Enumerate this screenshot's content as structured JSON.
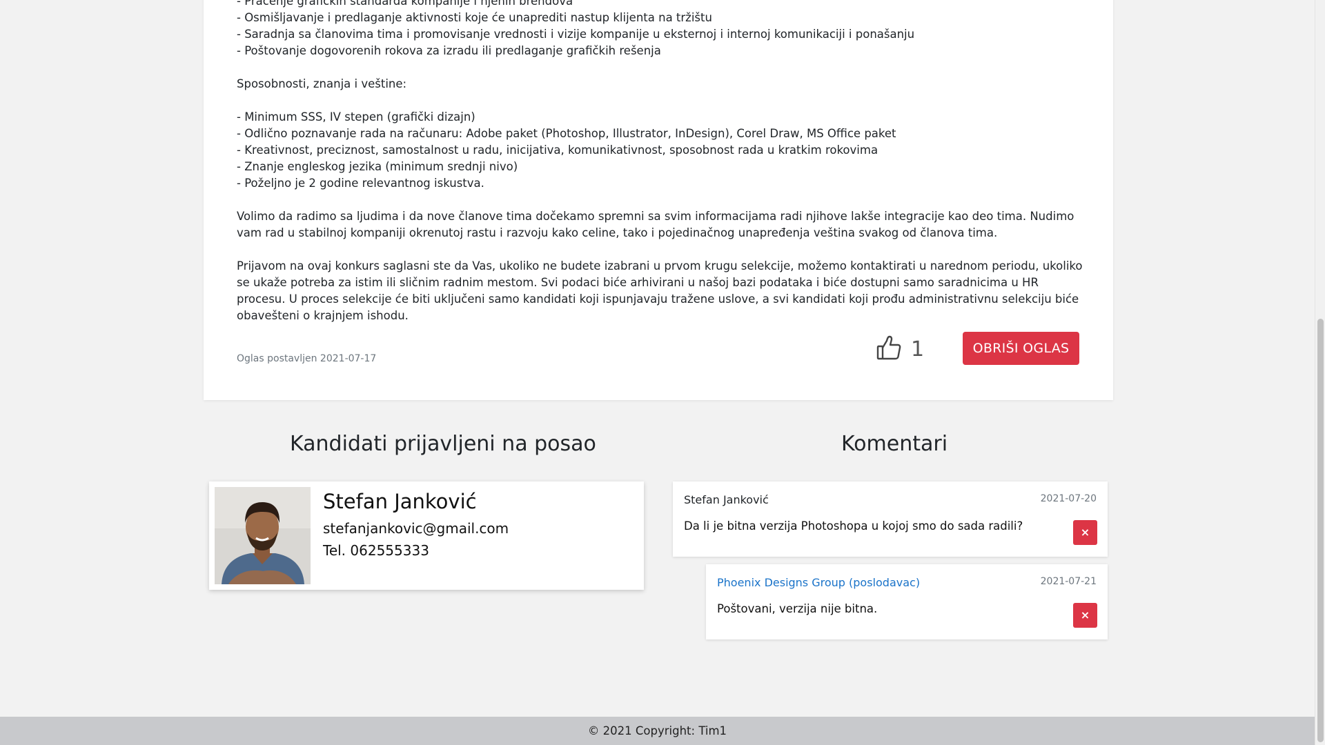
{
  "description": {
    "lines": [
      "- Praćenje grafičkih standarda kompanije i njenih brendova",
      "- Osmišljavanje i predlaganje aktivnosti koje će unaprediti nastup klijenta na tržištu",
      "- Saradnja sa članovima tima i promovisanje vrednosti i vizije kompanije u eksternoj i internoj komunikaciji i ponašanju",
      "- Poštovanje dogovorenih rokova za izradu ili predlaganje grafičkih rešenja"
    ],
    "skills_heading": "Sposobnosti, znanja i veštine:",
    "skills": [
      "- Minimum SSS, IV stepen (grafički dizajn)",
      "- Odlično poznavanje rada na računaru: Adobe paket (Photoshop, Illustrator, InDesign), Corel Draw, MS Office paket",
      "- Kreativnost, preciznost, samostalnost u radu, inicijativa, komunikativnost, sposobnost rada u kratkim rokovima",
      "- Znanje engleskog jezika (minimum srednji nivo)",
      "- Poželjno je 2 godine relevantnog iskustva."
    ],
    "paragraph1": "Volimo da radimo sa ljudima i da nove članove tima dočekamo spremni sa svim informacijama radi njihove lakše integracije kao deo tima. Nudimo vam rad u stabilnoj kompaniji okrenutoj rastu i razvoju kako celine, tako i pojedinačnog unapređenja veština svakog od članova tima.",
    "paragraph2": "Prijavom na ovaj konkurs saglasni ste da Vas, ukoliko ne budete izabrani u prvom krugu selekcije, možemo kontaktirati u narednom periodu, ukoliko se ukaže potreba za istim ili sličnim radnim mestom. Svi podaci biće arhivirani u našoj bazi podataka i biće dostupni samo saradnicima u HR procesu. U proces selekcije će biti uključeni samo kandidati koji ispunjavaju tražene uslove, a svi kandidati koji prođu administrativnu selekciju biće obavešteni o krajnjem ishodu."
  },
  "ad": {
    "posted": "Oglas postavljen 2021-07-17",
    "likes": "1",
    "delete_label": "OBRIŠI OGLAS",
    "like_icon": "thumbs-up-icon"
  },
  "candidates": {
    "title": "Kandidati prijavljeni na posao",
    "items": [
      {
        "name": "Stefan Janković",
        "email": "stefanjankovic@gmail.com",
        "phone": "Tel. 062555333"
      }
    ]
  },
  "comments": {
    "title": "Komentari",
    "items": [
      {
        "author": "Stefan Janković",
        "date": "2021-07-20",
        "text": "Da li je bitna verzija Photoshopa u kojoj smo do sada radili?",
        "delete_icon": "×"
      },
      {
        "author": "Phoenix Designs Group (poslodavac)",
        "date": "2021-07-21",
        "text": "Poštovani, verzija nije bitna.",
        "delete_icon": "×"
      }
    ]
  },
  "footer": {
    "text": "© 2021 Copyright: Tim1"
  },
  "colors": {
    "danger": "#dc3545",
    "link": "#1a73c9",
    "background": "#f2f2f2",
    "footer": "#c8c9cc"
  }
}
